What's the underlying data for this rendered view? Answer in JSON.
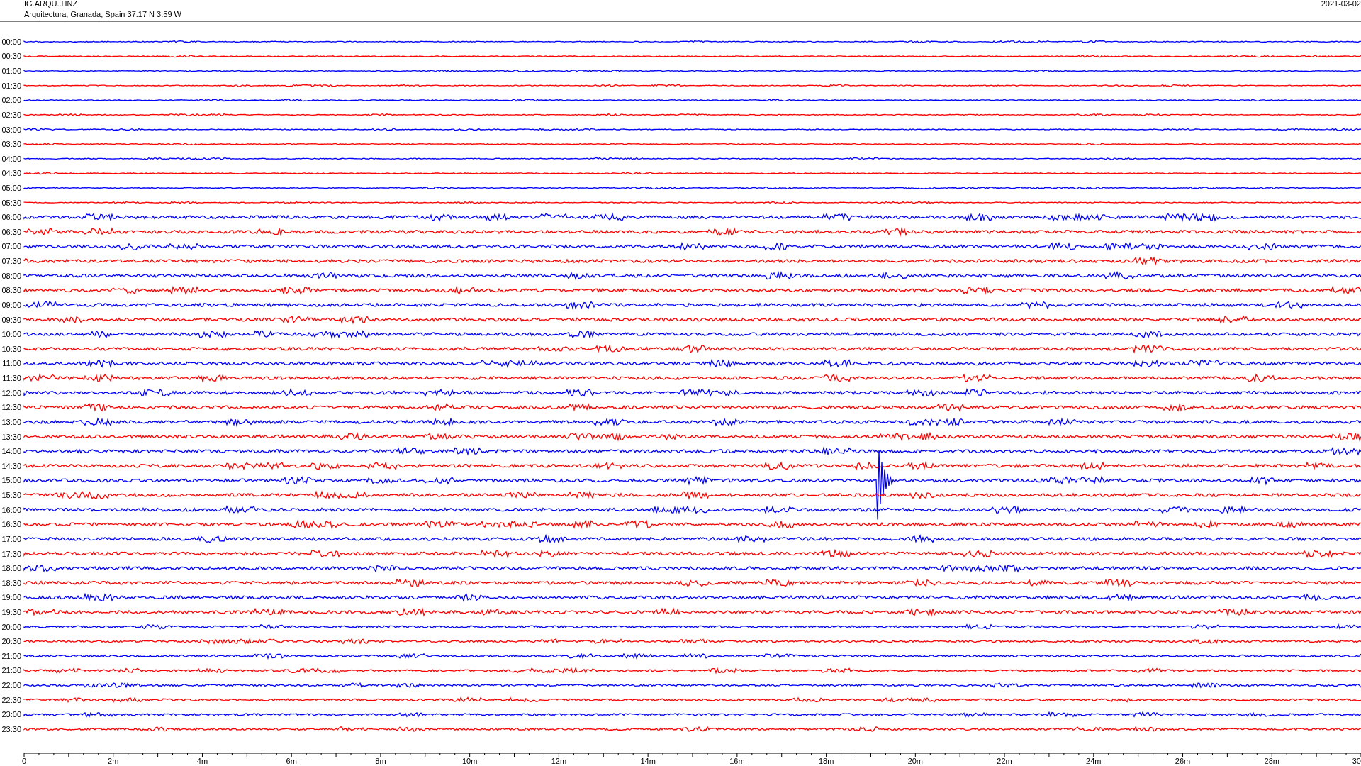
{
  "header": {
    "station": "IG.ARQU..HNZ",
    "description": "Arquitectura, Granada, Spain  37.17 N 3.59 W",
    "date": "2021-03-02"
  },
  "traces": [
    {
      "time": "00:00",
      "color": "#0000ff"
    },
    {
      "time": "00:30",
      "color": "#ff0000"
    },
    {
      "time": "01:00",
      "color": "#0000ff"
    },
    {
      "time": "01:30",
      "color": "#ff0000"
    },
    {
      "time": "02:00",
      "color": "#0000ff"
    },
    {
      "time": "02:30",
      "color": "#ff0000"
    },
    {
      "time": "03:00",
      "color": "#0000ff"
    },
    {
      "time": "03:30",
      "color": "#ff0000"
    },
    {
      "time": "04:00",
      "color": "#0000ff"
    },
    {
      "time": "04:30",
      "color": "#ff0000"
    },
    {
      "time": "05:00",
      "color": "#0000ff"
    },
    {
      "time": "05:30",
      "color": "#ff0000"
    },
    {
      "time": "06:00",
      "color": "#0000ff"
    },
    {
      "time": "06:30",
      "color": "#ff0000"
    },
    {
      "time": "07:00",
      "color": "#0000ff"
    },
    {
      "time": "07:30",
      "color": "#ff0000"
    },
    {
      "time": "08:00",
      "color": "#0000ff"
    },
    {
      "time": "08:30",
      "color": "#ff0000"
    },
    {
      "time": "09:00",
      "color": "#0000ff"
    },
    {
      "time": "09:30",
      "color": "#ff0000"
    },
    {
      "time": "10:00",
      "color": "#0000ff"
    },
    {
      "time": "10:30",
      "color": "#ff0000"
    },
    {
      "time": "11:00",
      "color": "#0000ff"
    },
    {
      "time": "11:30",
      "color": "#ff0000"
    },
    {
      "time": "12:00",
      "color": "#0000ff"
    },
    {
      "time": "12:30",
      "color": "#ff0000"
    },
    {
      "time": "13:00",
      "color": "#0000ff"
    },
    {
      "time": "13:30",
      "color": "#ff0000"
    },
    {
      "time": "14:00",
      "color": "#0000ff"
    },
    {
      "time": "14:30",
      "color": "#ff0000"
    },
    {
      "time": "15:00",
      "color": "#0000ff"
    },
    {
      "time": "15:30",
      "color": "#ff0000"
    },
    {
      "time": "16:00",
      "color": "#0000ff"
    },
    {
      "time": "16:30",
      "color": "#ff0000"
    },
    {
      "time": "17:00",
      "color": "#0000ff"
    },
    {
      "time": "17:30",
      "color": "#ff0000"
    },
    {
      "time": "18:00",
      "color": "#0000ff"
    },
    {
      "time": "18:30",
      "color": "#ff0000"
    },
    {
      "time": "19:00",
      "color": "#0000ff"
    },
    {
      "time": "19:30",
      "color": "#ff0000"
    },
    {
      "time": "20:00",
      "color": "#0000ff"
    },
    {
      "time": "20:30",
      "color": "#ff0000"
    },
    {
      "time": "21:00",
      "color": "#0000ff"
    },
    {
      "time": "21:30",
      "color": "#ff0000"
    },
    {
      "time": "22:00",
      "color": "#0000ff"
    },
    {
      "time": "22:30",
      "color": "#ff0000"
    },
    {
      "time": "23:00",
      "color": "#0000ff"
    },
    {
      "time": "23:30",
      "color": "#ff0000"
    }
  ],
  "axis": {
    "tick_labels": [
      "0",
      "2m",
      "4m",
      "6m",
      "8m",
      "10m",
      "12m",
      "14m",
      "16m",
      "18m",
      "20m",
      "22m",
      "24m",
      "26m",
      "28m",
      "30"
    ]
  }
}
